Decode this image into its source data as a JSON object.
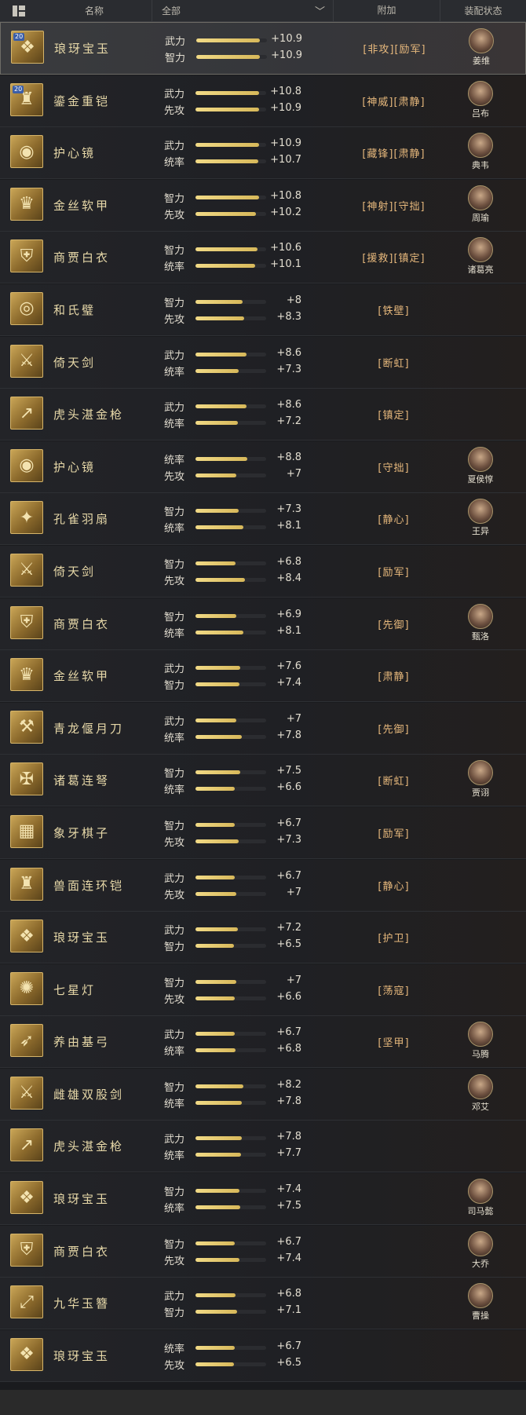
{
  "header": {
    "name_label": "名称",
    "filter_label": "全部",
    "extra_label": "附加",
    "status_label": "装配状态"
  },
  "rows": [
    {
      "name": "琅玡宝玉",
      "badge": "20",
      "glyph": "❖",
      "stat1": "武力",
      "val1": "+10.9",
      "fill1": 0.9,
      "stat2": "智力",
      "val2": "+10.9",
      "fill2": 0.9,
      "extra": "[非攻][励军]",
      "hero": "姜维",
      "selected": true
    },
    {
      "name": "鎏金重铠",
      "badge": "20",
      "glyph": "♜",
      "stat1": "武力",
      "val1": "+10.8",
      "fill1": 0.9,
      "stat2": "先攻",
      "val2": "+10.9",
      "fill2": 0.9,
      "extra": "[神威][肃静]",
      "hero": "吕布"
    },
    {
      "name": "护心镜",
      "glyph": "◉",
      "stat1": "武力",
      "val1": "+10.9",
      "fill1": 0.9,
      "stat2": "统率",
      "val2": "+10.7",
      "fill2": 0.89,
      "extra": "[藏锋][肃静]",
      "hero": "典韦"
    },
    {
      "name": "金丝软甲",
      "glyph": "♛",
      "stat1": "智力",
      "val1": "+10.8",
      "fill1": 0.9,
      "stat2": "先攻",
      "val2": "+10.2",
      "fill2": 0.85,
      "extra": "[神射][守拙]",
      "hero": "周瑜"
    },
    {
      "name": "商贾白衣",
      "glyph": "⛨",
      "stat1": "智力",
      "val1": "+10.6",
      "fill1": 0.88,
      "stat2": "统率",
      "val2": "+10.1",
      "fill2": 0.84,
      "extra": "[援救][镇定]",
      "hero": "诸葛亮"
    },
    {
      "name": "和氏璧",
      "glyph": "◎",
      "stat1": "智力",
      "val1": "+8",
      "fill1": 0.67,
      "stat2": "先攻",
      "val2": "+8.3",
      "fill2": 0.69,
      "extra": "[铁壁]",
      "hero": ""
    },
    {
      "name": "倚天剑",
      "glyph": "⚔",
      "stat1": "武力",
      "val1": "+8.6",
      "fill1": 0.72,
      "stat2": "统率",
      "val2": "+7.3",
      "fill2": 0.61,
      "extra": "[断虹]",
      "hero": ""
    },
    {
      "name": "虎头湛金枪",
      "glyph": "↗",
      "stat1": "武力",
      "val1": "+8.6",
      "fill1": 0.72,
      "stat2": "统率",
      "val2": "+7.2",
      "fill2": 0.6,
      "extra": "[镇定]",
      "hero": ""
    },
    {
      "name": "护心镜",
      "glyph": "◉",
      "stat1": "统率",
      "val1": "+8.8",
      "fill1": 0.73,
      "stat2": "先攻",
      "val2": "+7",
      "fill2": 0.58,
      "extra": "[守拙]",
      "hero": "夏侯惇"
    },
    {
      "name": "孔雀羽扇",
      "glyph": "✦",
      "stat1": "智力",
      "val1": "+7.3",
      "fill1": 0.61,
      "stat2": "统率",
      "val2": "+8.1",
      "fill2": 0.68,
      "extra": "[静心]",
      "hero": "王异"
    },
    {
      "name": "倚天剑",
      "glyph": "⚔",
      "stat1": "智力",
      "val1": "+6.8",
      "fill1": 0.57,
      "stat2": "先攻",
      "val2": "+8.4",
      "fill2": 0.7,
      "extra": "[励军]",
      "hero": ""
    },
    {
      "name": "商贾白衣",
      "glyph": "⛨",
      "stat1": "智力",
      "val1": "+6.9",
      "fill1": 0.58,
      "stat2": "统率",
      "val2": "+8.1",
      "fill2": 0.68,
      "extra": "[先御]",
      "hero": "甄洛"
    },
    {
      "name": "金丝软甲",
      "glyph": "♛",
      "stat1": "武力",
      "val1": "+7.6",
      "fill1": 0.63,
      "stat2": "智力",
      "val2": "+7.4",
      "fill2": 0.62,
      "extra": "[肃静]",
      "hero": ""
    },
    {
      "name": "青龙偃月刀",
      "glyph": "⚒",
      "stat1": "武力",
      "val1": "+7",
      "fill1": 0.58,
      "stat2": "统率",
      "val2": "+7.8",
      "fill2": 0.65,
      "extra": "[先御]",
      "hero": ""
    },
    {
      "name": "诸葛连弩",
      "glyph": "✠",
      "stat1": "智力",
      "val1": "+7.5",
      "fill1": 0.63,
      "stat2": "统率",
      "val2": "+6.6",
      "fill2": 0.55,
      "extra": "[断虹]",
      "hero": "贾诩"
    },
    {
      "name": "象牙棋子",
      "glyph": "▦",
      "stat1": "智力",
      "val1": "+6.7",
      "fill1": 0.56,
      "stat2": "先攻",
      "val2": "+7.3",
      "fill2": 0.61,
      "extra": "[励军]",
      "hero": ""
    },
    {
      "name": "兽面连环铠",
      "glyph": "♜",
      "stat1": "武力",
      "val1": "+6.7",
      "fill1": 0.56,
      "stat2": "先攻",
      "val2": "+7",
      "fill2": 0.58,
      "extra": "[静心]",
      "hero": ""
    },
    {
      "name": "琅玡宝玉",
      "glyph": "❖",
      "stat1": "武力",
      "val1": "+7.2",
      "fill1": 0.6,
      "stat2": "智力",
      "val2": "+6.5",
      "fill2": 0.54,
      "extra": "[护卫]",
      "hero": ""
    },
    {
      "name": "七星灯",
      "glyph": "✺",
      "stat1": "智力",
      "val1": "+7",
      "fill1": 0.58,
      "stat2": "先攻",
      "val2": "+6.6",
      "fill2": 0.55,
      "extra": "[荡寇]",
      "hero": ""
    },
    {
      "name": "养由基弓",
      "glyph": "➶",
      "stat1": "武力",
      "val1": "+6.7",
      "fill1": 0.56,
      "stat2": "统率",
      "val2": "+6.8",
      "fill2": 0.57,
      "extra": "[坚甲]",
      "hero": "马腾"
    },
    {
      "name": "雌雄双股剑",
      "glyph": "⚔",
      "stat1": "智力",
      "val1": "+8.2",
      "fill1": 0.68,
      "stat2": "统率",
      "val2": "+7.8",
      "fill2": 0.65,
      "extra": "",
      "hero": "邓艾"
    },
    {
      "name": "虎头湛金枪",
      "glyph": "↗",
      "stat1": "武力",
      "val1": "+7.8",
      "fill1": 0.65,
      "stat2": "统率",
      "val2": "+7.7",
      "fill2": 0.64,
      "extra": "",
      "hero": ""
    },
    {
      "name": "琅玡宝玉",
      "glyph": "❖",
      "stat1": "智力",
      "val1": "+7.4",
      "fill1": 0.62,
      "stat2": "统率",
      "val2": "+7.5",
      "fill2": 0.63,
      "extra": "",
      "hero": "司马懿"
    },
    {
      "name": "商贾白衣",
      "glyph": "⛨",
      "stat1": "智力",
      "val1": "+6.7",
      "fill1": 0.56,
      "stat2": "先攻",
      "val2": "+7.4",
      "fill2": 0.62,
      "extra": "",
      "hero": "大乔"
    },
    {
      "name": "九华玉簪",
      "glyph": "⤢",
      "stat1": "武力",
      "val1": "+6.8",
      "fill1": 0.57,
      "stat2": "智力",
      "val2": "+7.1",
      "fill2": 0.59,
      "extra": "",
      "hero": "曹操"
    },
    {
      "name": "琅玡宝玉",
      "glyph": "❖",
      "stat1": "统率",
      "val1": "+6.7",
      "fill1": 0.56,
      "stat2": "先攻",
      "val2": "+6.5",
      "fill2": 0.54,
      "extra": "",
      "hero": ""
    }
  ]
}
